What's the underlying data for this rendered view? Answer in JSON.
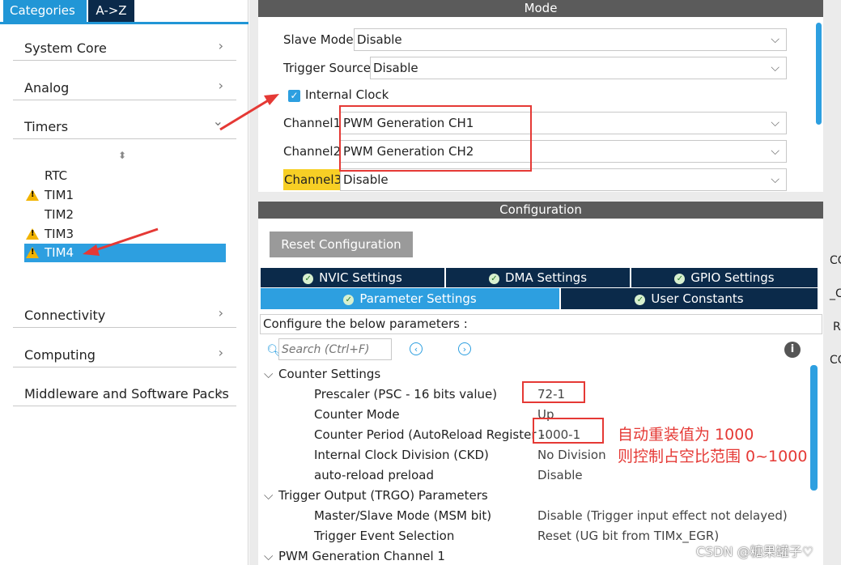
{
  "left": {
    "tabs": {
      "categories": "Categories",
      "az": "A->Z"
    },
    "categories": [
      {
        "label": "System Core",
        "chevron": "›"
      },
      {
        "label": "Analog",
        "chevron": "›"
      },
      {
        "label": "Timers",
        "chevron": "⌄"
      },
      {
        "label": "Connectivity",
        "chevron": "›"
      },
      {
        "label": "Computing",
        "chevron": "›"
      },
      {
        "label": "Middleware and Software Packs",
        "chevron": "›"
      }
    ],
    "sort_glyph": "⬍",
    "timers": [
      "RTC",
      "TIM1",
      "TIM2",
      "TIM3",
      "TIM4"
    ]
  },
  "mode": {
    "title": "Mode",
    "slave_mode": {
      "label": "Slave Mode",
      "value": "Disable"
    },
    "trigger_source": {
      "label": "Trigger Source",
      "value": "Disable"
    },
    "internal_clock": {
      "label": "Internal Clock",
      "checked": true
    },
    "channel1": {
      "label": "Channel1",
      "value": "PWM Generation CH1"
    },
    "channel2": {
      "label": "Channel2",
      "value": "PWM Generation CH2"
    },
    "channel3": {
      "label": "Channel3",
      "value": "Disable"
    }
  },
  "configuration": {
    "title": "Configuration",
    "reset_button": "Reset Configuration",
    "tabs_row1": [
      "NVIC Settings",
      "DMA Settings",
      "GPIO Settings"
    ],
    "tabs_row2": [
      "Parameter Settings",
      "User Constants"
    ],
    "desc": "Configure the below parameters :",
    "search_placeholder": "Search (Ctrl+F)",
    "groups": {
      "counter": "Counter Settings",
      "trgo": "Trigger Output (TRGO) Parameters",
      "pwm1": "PWM Generation Channel 1"
    },
    "params": [
      {
        "label": "Prescaler (PSC - 16 bits value)",
        "value": "72-1"
      },
      {
        "label": "Counter Mode",
        "value": "Up"
      },
      {
        "label": "Counter Period (AutoReload Register -",
        "value": "1000-1"
      },
      {
        "label": "Internal Clock Division (CKD)",
        "value": "No Division"
      },
      {
        "label": "auto-reload preload",
        "value": "Disable"
      }
    ],
    "trgo_params": [
      {
        "label": "Master/Slave Mode (MSM bit)",
        "value": "Disable (Trigger input effect not delayed)"
      },
      {
        "label": "Trigger Event Selection",
        "value": "Reset (UG bit from TIMx_EGR)"
      }
    ]
  },
  "annotations": {
    "line1": "自动重装值为 1000",
    "line2": "则控制占空比范围 0~1000"
  },
  "edge_fragments": [
    "CO",
    "_C",
    "R",
    "CO"
  ],
  "watermark": "CSDN @糖果罐子♡",
  "colors": {
    "accent": "#2d9fe0",
    "dark_nav": "#0b2a4a",
    "annotation_red": "#e53935",
    "warning": "#f2b400"
  }
}
